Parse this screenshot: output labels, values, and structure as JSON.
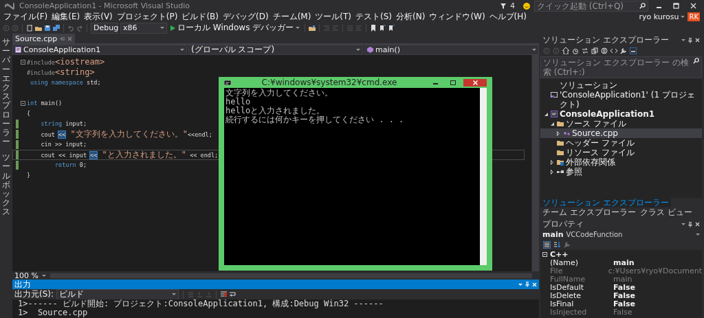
{
  "window": {
    "title": "ConsoleApplication1 - Microsoft Visual Studio"
  },
  "notifications": {
    "count": "4"
  },
  "quick_launch": {
    "placeholder": "クイック起動 (Ctrl+Q)"
  },
  "user": {
    "name": "ryo kurosu",
    "initials": "RK"
  },
  "menu": [
    "ファイル(F)",
    "編集(E)",
    "表示(V)",
    "プロジェクト(P)",
    "ビルド(B)",
    "デバッグ(D)",
    "チーム(M)",
    "ツール(T)",
    "テスト(S)",
    "分析(N)",
    "ウィンドウ(W)",
    "ヘルプ(H)"
  ],
  "toolbar": {
    "configuration": "Debug",
    "platform": "x86",
    "debugger": "ローカル Windows デバッガー"
  },
  "side_tabs": [
    "サーバーエクスプローラー",
    "ツールボックス"
  ],
  "editor": {
    "tabs": [
      {
        "label": "Source.cpp",
        "selected": true
      }
    ],
    "project": "ConsoleApplication1",
    "scope": "(グローバル スコープ)",
    "member": "main()",
    "zoom": "100 %",
    "lines": [
      {
        "collapsible": true,
        "changed": false,
        "current": false,
        "tokens": [
          {
            "kind": "pp",
            "text": "#include"
          },
          {
            "kind": "str",
            "text": "<iostream>"
          }
        ]
      },
      {
        "collapsible": false,
        "changed": false,
        "current": false,
        "tokens": [
          {
            "kind": "pp",
            "text": "#include"
          },
          {
            "kind": "str",
            "text": "<string>"
          }
        ]
      },
      {
        "collapsible": false,
        "changed": false,
        "current": false,
        "tokens": [
          {
            "kind": "kw",
            "text": " using"
          },
          {
            "kind": "kw",
            "text": " namespace"
          },
          {
            "kind": "plain",
            "text": " std;"
          }
        ]
      },
      {
        "collapsible": false,
        "changed": false,
        "current": false
      },
      {
        "collapsible": true,
        "changed": false,
        "current": false,
        "tokens": [
          {
            "kind": "kw",
            "text": "int"
          },
          {
            "kind": "plain",
            "text": " main()"
          }
        ]
      },
      {
        "collapsible": false,
        "changed": false,
        "current": false,
        "tokens": [
          {
            "kind": "plain",
            "text": "{"
          }
        ]
      },
      {
        "collapsible": false,
        "changed": true,
        "current": false,
        "tokens": [
          {
            "kind": "kw",
            "text": "    string"
          },
          {
            "kind": "plain",
            "text": " input;"
          }
        ]
      },
      {
        "collapsible": false,
        "changed": true,
        "current": false,
        "tokens": [
          {
            "kind": "plain",
            "text": "    cout "
          },
          {
            "kind": "hl",
            "text": "<<"
          },
          {
            "kind": "str",
            "text": " \"文字列を入力してください。\""
          },
          {
            "kind": "plain",
            "text": "<<endl;"
          }
        ]
      },
      {
        "collapsible": false,
        "changed": true,
        "current": false,
        "tokens": [
          {
            "kind": "plain",
            "text": "    cin >> input;"
          }
        ]
      },
      {
        "collapsible": false,
        "changed": true,
        "current": true,
        "tokens": [
          {
            "kind": "plain",
            "text": "    cout << input "
          },
          {
            "kind": "hl",
            "text": "<<"
          },
          {
            "kind": "str",
            "text": " \"と入力されました。\""
          },
          {
            "kind": "plain",
            "text": " << endl;"
          }
        ]
      },
      {
        "collapsible": false,
        "changed": true,
        "current": false,
        "tokens": [
          {
            "kind": "kw",
            "text": "        return"
          },
          {
            "kind": "plain",
            "text": " 0;"
          }
        ]
      },
      {
        "collapsible": false,
        "changed": false,
        "current": false,
        "tokens": [
          {
            "kind": "plain",
            "text": "}"
          }
        ]
      }
    ]
  },
  "output": {
    "title": "出力",
    "source_label": "出力元(S):",
    "source": "ビルド",
    "lines": [
      "1>------ ビルド開始: プロジェクト:ConsoleApplication1, 構成:Debug Win32 ------",
      "1>  Source.cpp"
    ]
  },
  "console": {
    "title": "C:¥windows¥system32¥cmd.exe",
    "lines": [
      "文字列を入力してください。",
      "hello",
      "helloと入力されました。",
      "続行するには何かキーを押してください . . ."
    ]
  },
  "solution_explorer": {
    "title": "ソリューション エクスプローラー",
    "search": {
      "placeholder": "ソリューション エクスプローラー の検索 (Ctrl+:)"
    },
    "tree": [
      {
        "label": "ソリューション 'ConsoleApplication1' (1 プロジェクト)",
        "kind": "solution",
        "selected": false
      },
      {
        "label": "ConsoleApplication1",
        "kind": "project",
        "selected": false,
        "expanded": true,
        "children": [
          {
            "label": "ソース ファイル",
            "kind": "folder",
            "selected": false,
            "expanded": true,
            "children": [
              {
                "label": "Source.cpp",
                "kind": "cpp",
                "selected": true,
                "expanded": false
              }
            ]
          },
          {
            "label": "ヘッダー ファイル",
            "kind": "folder",
            "selected": false
          },
          {
            "label": "リソース ファイル",
            "kind": "folder",
            "selected": false
          },
          {
            "label": "外部依存関係",
            "kind": "deps",
            "selected": false,
            "expanded": false
          },
          {
            "label": "参照",
            "kind": "refs",
            "selected": false,
            "expanded": false
          }
        ]
      }
    ],
    "tabs": [
      {
        "label": "ソリューション エクスプローラー",
        "selected": true
      },
      {
        "label": "チーム エクスプローラー",
        "selected": false
      },
      {
        "label": "クラス ビュー",
        "selected": false
      }
    ]
  },
  "properties": {
    "title": "プロパティ",
    "object_name": "main",
    "object_type": "VCCodeFunction",
    "category": "C++",
    "rows": [
      {
        "name": "(Name)",
        "value": "main",
        "disabled": false
      },
      {
        "name": "File",
        "value": "c:¥Users¥ryo¥Document",
        "disabled": true
      },
      {
        "name": "FullName",
        "value": "main",
        "disabled": true
      },
      {
        "name": "IsDefault",
        "value": "False",
        "disabled": false
      },
      {
        "name": "IsDelete",
        "value": "False",
        "disabled": false
      },
      {
        "name": "IsFinal",
        "value": "False",
        "disabled": false
      },
      {
        "name": "IsInjected",
        "value": "False",
        "disabled": true
      }
    ]
  }
}
